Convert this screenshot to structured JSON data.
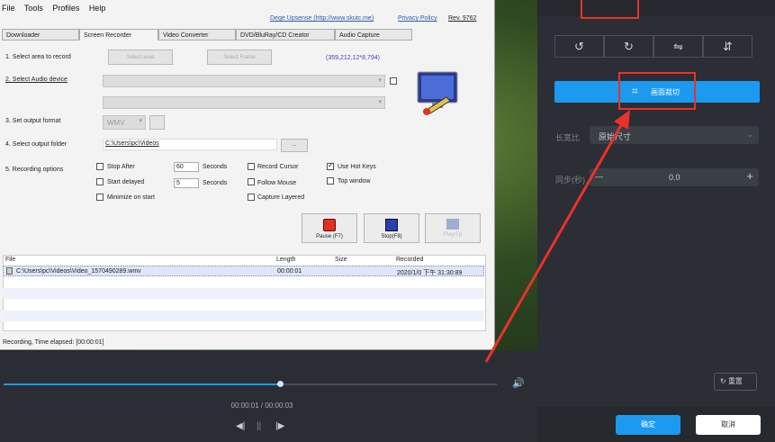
{
  "menu": [
    "File",
    "Tools",
    "Profiles",
    "Help"
  ],
  "links": {
    "site": "Dege Upsense (http://www.skutc.me)",
    "privacy": "Privacy Policy",
    "rev": "Rev. 9762"
  },
  "tabs": [
    "Downloader",
    "Screen Recorder",
    "Video Converter",
    "DVD/BluRay/CD Creator",
    "Audio Capture"
  ],
  "options": {
    "area_label": "1. Select area to record",
    "select_area": "Select area",
    "select_frame": "Select Frame",
    "coords": "(359,212,12*8,794)",
    "audio_label": "2. Select Audio device",
    "format_label": "3. Set output format",
    "format_value": "WMV",
    "folder_label": "4. Select output folder",
    "folder_value": "C:\\Users\\pc\\Videos",
    "browse": "...",
    "rec_label": "5. Recording options",
    "stop_after": "Stop After",
    "stop_value": "60",
    "seconds1": "Seconds",
    "start_delayed": "Start delayed",
    "start_value": "5",
    "seconds2": "Seconds",
    "minimize": "Minimize on start",
    "record_cursor": "Record Cursor",
    "follow_mouse": "Follow Mouse",
    "capture_layered": "Capture Layered",
    "use_hotkeys": "Use Hot Keys",
    "top_window": "Top window"
  },
  "controls": {
    "pause": "Pause (F7)",
    "stop": "Stop(F8)",
    "play": "Play/Tp"
  },
  "table": {
    "headers": [
      "File",
      "Length",
      "Size",
      "Recorded"
    ],
    "rows": [
      {
        "file": "C:\\Users\\pc\\Videos\\Video_1570490289.wmv",
        "length": "00:00:01",
        "size": "",
        "recorded": "2020/1/0 下午 31:30:89"
      }
    ]
  },
  "status": "Recording, Time elapsed: [00:00:01]",
  "player": {
    "time": "00:00:01 / 00:00:03",
    "progress": 0.56
  },
  "right": {
    "crop_button": "画面裁切",
    "ratio_label": "长宽比",
    "ratio_value": "原始尺寸",
    "sync_label": "同步(秒)",
    "sync_value": "0.0",
    "minus": "—",
    "plus": "+",
    "reset": "重置",
    "confirm": "确定",
    "cancel": "取消"
  },
  "colors": {
    "accent": "#1b9af0",
    "annotation": "#e8322b"
  }
}
